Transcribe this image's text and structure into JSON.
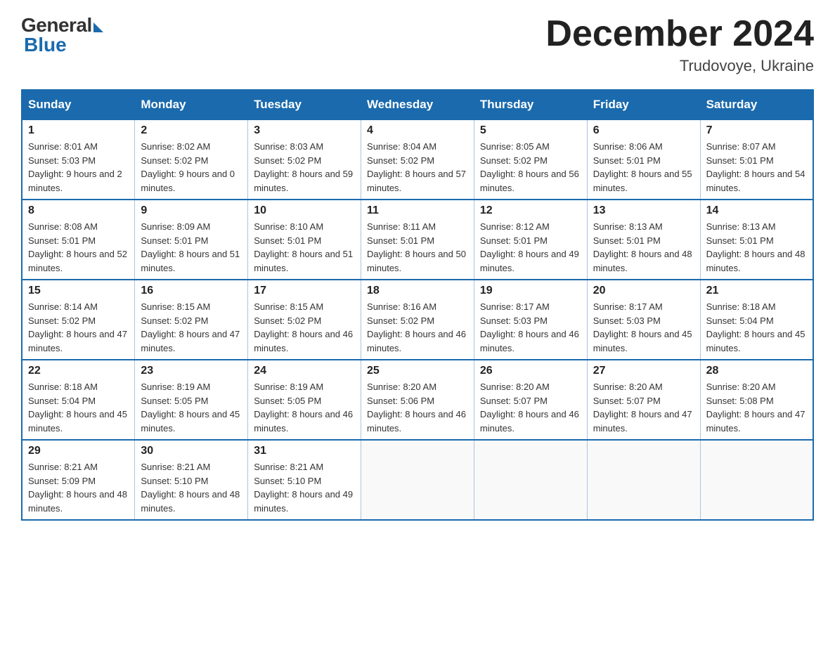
{
  "header": {
    "logo_general": "General",
    "logo_blue": "Blue",
    "month_title": "December 2024",
    "location": "Trudovoye, Ukraine"
  },
  "calendar": {
    "days_of_week": [
      "Sunday",
      "Monday",
      "Tuesday",
      "Wednesday",
      "Thursday",
      "Friday",
      "Saturday"
    ],
    "weeks": [
      [
        {
          "day": "1",
          "sunrise": "8:01 AM",
          "sunset": "5:03 PM",
          "daylight": "9 hours and 2 minutes."
        },
        {
          "day": "2",
          "sunrise": "8:02 AM",
          "sunset": "5:02 PM",
          "daylight": "9 hours and 0 minutes."
        },
        {
          "day": "3",
          "sunrise": "8:03 AM",
          "sunset": "5:02 PM",
          "daylight": "8 hours and 59 minutes."
        },
        {
          "day": "4",
          "sunrise": "8:04 AM",
          "sunset": "5:02 PM",
          "daylight": "8 hours and 57 minutes."
        },
        {
          "day": "5",
          "sunrise": "8:05 AM",
          "sunset": "5:02 PM",
          "daylight": "8 hours and 56 minutes."
        },
        {
          "day": "6",
          "sunrise": "8:06 AM",
          "sunset": "5:01 PM",
          "daylight": "8 hours and 55 minutes."
        },
        {
          "day": "7",
          "sunrise": "8:07 AM",
          "sunset": "5:01 PM",
          "daylight": "8 hours and 54 minutes."
        }
      ],
      [
        {
          "day": "8",
          "sunrise": "8:08 AM",
          "sunset": "5:01 PM",
          "daylight": "8 hours and 52 minutes."
        },
        {
          "day": "9",
          "sunrise": "8:09 AM",
          "sunset": "5:01 PM",
          "daylight": "8 hours and 51 minutes."
        },
        {
          "day": "10",
          "sunrise": "8:10 AM",
          "sunset": "5:01 PM",
          "daylight": "8 hours and 51 minutes."
        },
        {
          "day": "11",
          "sunrise": "8:11 AM",
          "sunset": "5:01 PM",
          "daylight": "8 hours and 50 minutes."
        },
        {
          "day": "12",
          "sunrise": "8:12 AM",
          "sunset": "5:01 PM",
          "daylight": "8 hours and 49 minutes."
        },
        {
          "day": "13",
          "sunrise": "8:13 AM",
          "sunset": "5:01 PM",
          "daylight": "8 hours and 48 minutes."
        },
        {
          "day": "14",
          "sunrise": "8:13 AM",
          "sunset": "5:01 PM",
          "daylight": "8 hours and 48 minutes."
        }
      ],
      [
        {
          "day": "15",
          "sunrise": "8:14 AM",
          "sunset": "5:02 PM",
          "daylight": "8 hours and 47 minutes."
        },
        {
          "day": "16",
          "sunrise": "8:15 AM",
          "sunset": "5:02 PM",
          "daylight": "8 hours and 47 minutes."
        },
        {
          "day": "17",
          "sunrise": "8:15 AM",
          "sunset": "5:02 PM",
          "daylight": "8 hours and 46 minutes."
        },
        {
          "day": "18",
          "sunrise": "8:16 AM",
          "sunset": "5:02 PM",
          "daylight": "8 hours and 46 minutes."
        },
        {
          "day": "19",
          "sunrise": "8:17 AM",
          "sunset": "5:03 PM",
          "daylight": "8 hours and 46 minutes."
        },
        {
          "day": "20",
          "sunrise": "8:17 AM",
          "sunset": "5:03 PM",
          "daylight": "8 hours and 45 minutes."
        },
        {
          "day": "21",
          "sunrise": "8:18 AM",
          "sunset": "5:04 PM",
          "daylight": "8 hours and 45 minutes."
        }
      ],
      [
        {
          "day": "22",
          "sunrise": "8:18 AM",
          "sunset": "5:04 PM",
          "daylight": "8 hours and 45 minutes."
        },
        {
          "day": "23",
          "sunrise": "8:19 AM",
          "sunset": "5:05 PM",
          "daylight": "8 hours and 45 minutes."
        },
        {
          "day": "24",
          "sunrise": "8:19 AM",
          "sunset": "5:05 PM",
          "daylight": "8 hours and 46 minutes."
        },
        {
          "day": "25",
          "sunrise": "8:20 AM",
          "sunset": "5:06 PM",
          "daylight": "8 hours and 46 minutes."
        },
        {
          "day": "26",
          "sunrise": "8:20 AM",
          "sunset": "5:07 PM",
          "daylight": "8 hours and 46 minutes."
        },
        {
          "day": "27",
          "sunrise": "8:20 AM",
          "sunset": "5:07 PM",
          "daylight": "8 hours and 47 minutes."
        },
        {
          "day": "28",
          "sunrise": "8:20 AM",
          "sunset": "5:08 PM",
          "daylight": "8 hours and 47 minutes."
        }
      ],
      [
        {
          "day": "29",
          "sunrise": "8:21 AM",
          "sunset": "5:09 PM",
          "daylight": "8 hours and 48 minutes."
        },
        {
          "day": "30",
          "sunrise": "8:21 AM",
          "sunset": "5:10 PM",
          "daylight": "8 hours and 48 minutes."
        },
        {
          "day": "31",
          "sunrise": "8:21 AM",
          "sunset": "5:10 PM",
          "daylight": "8 hours and 49 minutes."
        },
        null,
        null,
        null,
        null
      ]
    ]
  }
}
